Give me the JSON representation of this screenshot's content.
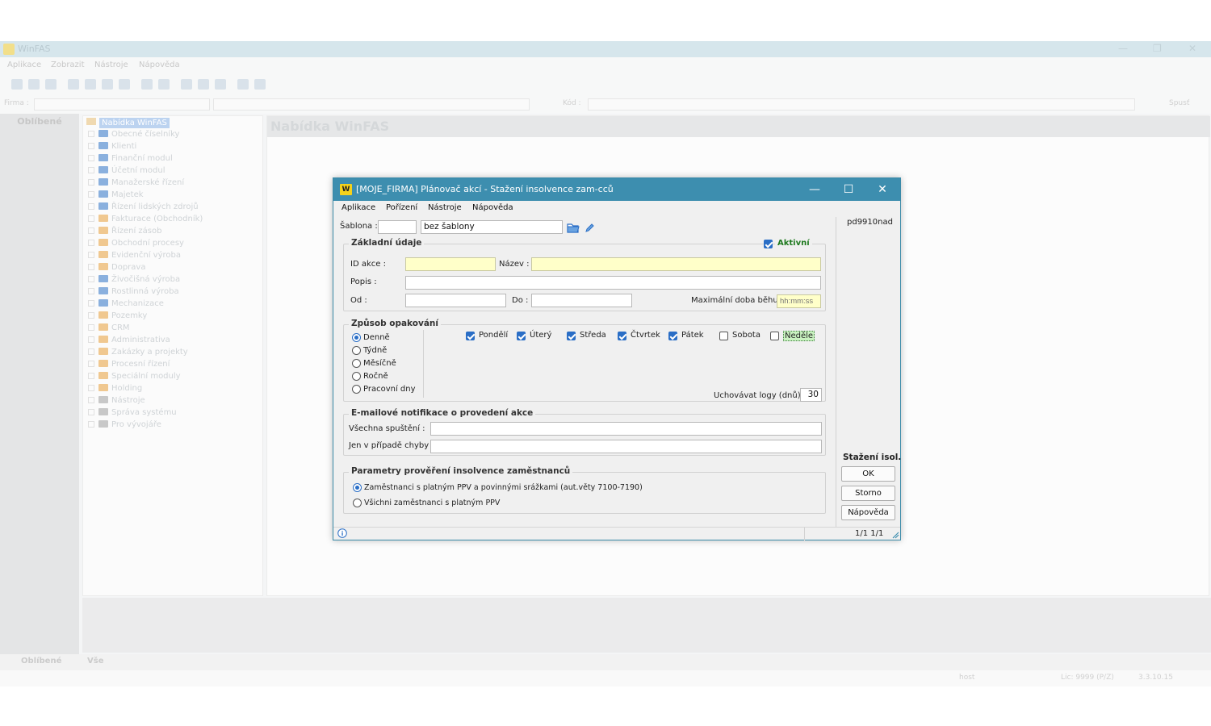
{
  "background": {
    "app_title": "WinFAS",
    "menu": [
      "Aplikace",
      "Zobrazit",
      "Nástroje",
      "Nápověda"
    ],
    "firm_label": "Firma :",
    "kod_label": "Kód :",
    "run_button": "Spusť",
    "favorites_header": "Oblíbené",
    "tree_root": "Nabídka WinFAS",
    "tree_items": [
      "Obecné číselníky",
      "Klienti",
      "Finanční modul",
      "Účetní modul",
      "Manažerské řízení",
      "Majetek",
      "Řízení lidských zdrojů",
      "Fakturace (Obchodník)",
      "Řízení zásob",
      "Obchodní procesy",
      "Evidenční výroba",
      "Doprava",
      "Živočišná výroba",
      "Rostlinná výroba",
      "Mechanizace",
      "Pozemky",
      "CRM",
      "Administrativa",
      "Zakázky a projekty",
      "Procesní řízení",
      "Speciální moduly",
      "Holding",
      "Nástroje",
      "Správa systému",
      "Pro vývojáře"
    ],
    "content_header": "Nabídka WinFAS",
    "bottom_tabs": [
      "Oblíbené",
      "Vše"
    ],
    "status_user": "host",
    "status_lic": "Lic: 9999 (P/Z)",
    "status_version": "3.3.10.15"
  },
  "dialog": {
    "title": "[MOJE_FIRMA] Plánovač akcí - Stažení insolvence zam-cců",
    "logo_text": "W",
    "menu": {
      "aplikace": "Aplikace",
      "porizeni": "Pořízení",
      "nastroje": "Nástroje",
      "napoveda": "Nápověda"
    },
    "code": "pd9910nad",
    "sablona_label": "Šablona :",
    "sablona_code": "",
    "sablona_value": "bez šablony",
    "zakladni": {
      "title": "Základní údaje",
      "aktivni_label": "Aktivní",
      "aktivni_checked": true,
      "id_label": "ID akce :",
      "id_value": "",
      "nazev_label": "Název :",
      "nazev_value": "",
      "popis_label": "Popis :",
      "popis_value": "",
      "od_label": "Od :",
      "od_value": "",
      "do_label": "Do :",
      "do_value": "",
      "max_label": "Maximální doba běhu :",
      "max_placeholder": "hh:mm:ss"
    },
    "opakovani": {
      "title": "Způsob opakování",
      "options": [
        {
          "label": "Denně",
          "selected": true
        },
        {
          "label": "Týdně",
          "selected": false
        },
        {
          "label": "Měsíčně",
          "selected": false
        },
        {
          "label": "Ročně",
          "selected": false
        },
        {
          "label": "Pracovní dny",
          "selected": false
        }
      ],
      "days": [
        {
          "label": "Pondělí",
          "checked": true
        },
        {
          "label": "Úterý",
          "checked": true
        },
        {
          "label": "Středa",
          "checked": true
        },
        {
          "label": "Čtvrtek",
          "checked": true
        },
        {
          "label": "Pátek",
          "checked": true
        },
        {
          "label": "Sobota",
          "checked": false
        },
        {
          "label": "Neděle",
          "checked": false
        }
      ],
      "logs_label": "Uchovávat logy (dnů) :",
      "logs_value": "30"
    },
    "email": {
      "title": "E-mailové notifikace o provedení akce",
      "all_label": "Všechna spuštění :",
      "all_value": "",
      "error_label": "Jen v případě chyby :",
      "error_value": ""
    },
    "parametry": {
      "title": "Parametry prověření insolvence zaměstnanců",
      "options": [
        {
          "label": "Zaměstnanci s platným PPV a povinnými srážkami (aut.věty 7100-7190)",
          "selected": true
        },
        {
          "label": "Všichni zaměstnanci s platným PPV",
          "selected": false
        }
      ]
    },
    "side_title": "Stažení isol.",
    "buttons": {
      "ok": "OK",
      "storno": "Storno",
      "napoveda": "Nápověda"
    },
    "status_pages": "1/1  1/1"
  },
  "colors": {
    "title_bar": "#3d8eaf",
    "accent": "#2a6ec6",
    "required_field": "#ffffc9",
    "aktivni_text": "#1f7a1f"
  }
}
